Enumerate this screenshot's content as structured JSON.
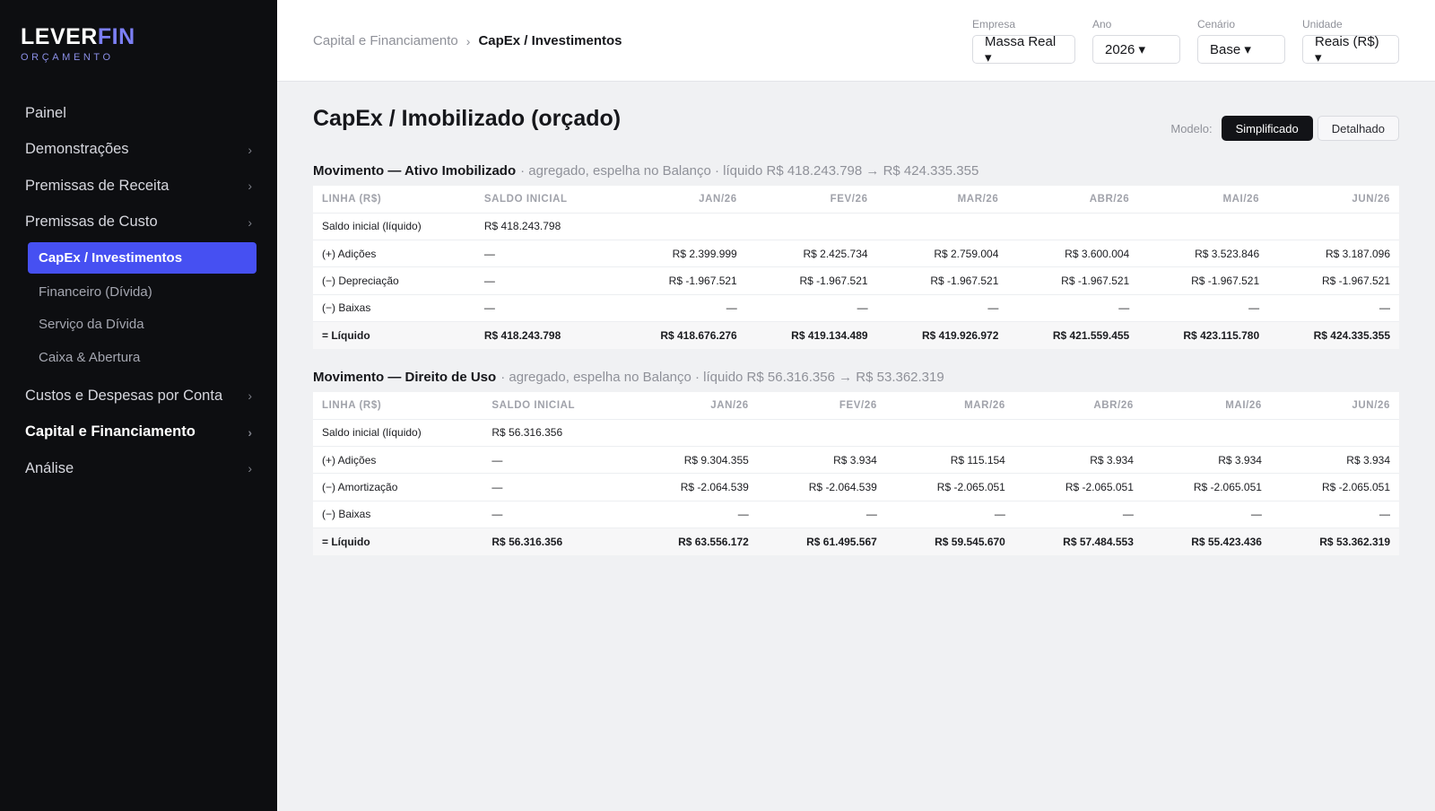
{
  "brand": {
    "main": "LEVER",
    "accent": "FIN",
    "sub": "ORÇAMENTO"
  },
  "nav": {
    "painel": "Painel",
    "demonstracoes": "Demonstrações",
    "premissas_receita": "Premissas de Receita",
    "premissas_custo": "Premissas de Custo",
    "sub_capex": "CapEx / Investimentos",
    "sub_financeiro": "Financeiro (Dívida)",
    "sub_servico": "Serviço da Dívida",
    "sub_caixa": "Caixa & Abertura",
    "custos_despesas": "Custos e Despesas por Conta",
    "capital_fin": "Capital e Financiamento",
    "analise": "Análise",
    "chevron": "›"
  },
  "breadcrumb": {
    "parent": "Capital e Financiamento",
    "sep": "›",
    "current": "CapEx / Investimentos"
  },
  "filters": {
    "empresa": {
      "label": "Empresa",
      "value": "Massa Real ▾"
    },
    "ano": {
      "label": "Ano",
      "value": "2026 ▾"
    },
    "cenario": {
      "label": "Cenário",
      "value": "Base ▾"
    },
    "unidade": {
      "label": "Unidade",
      "value": "Reais (R$) ▾"
    }
  },
  "page": {
    "title": "CapEx / Imobilizado (orçado)",
    "model_label": "Modelo:",
    "model_simplified": "Simplificado",
    "model_detailed": "Detalhado"
  },
  "sections": [
    {
      "title": "Movimento — Ativo Imobilizado",
      "subtitle": "· agregado, espelha no Balanço · líquido R$ 418.243.798 → R$ 424.335.355",
      "headers": [
        "LINHA (R$)",
        "SALDO INICIAL",
        "JAN/26",
        "FEV/26",
        "MAR/26",
        "ABR/26",
        "MAI/26",
        "JUN/26"
      ],
      "rows": [
        [
          "Saldo inicial (líquido)",
          "R$ 418.243.798",
          "",
          "",
          "",
          "",
          "",
          ""
        ],
        [
          "(+) Adições",
          "—",
          "R$ 2.399.999",
          "R$ 2.425.734",
          "R$ 2.759.004",
          "R$ 3.600.004",
          "R$ 3.523.846",
          "R$ 3.187.096"
        ],
        [
          "(−) Depreciação",
          "—",
          "R$ -1.967.521",
          "R$ -1.967.521",
          "R$ -1.967.521",
          "R$ -1.967.521",
          "R$ -1.967.521",
          "R$ -1.967.521"
        ],
        [
          "(−) Baixas",
          "—",
          "—",
          "—",
          "—",
          "—",
          "—",
          "—"
        ],
        [
          "= Líquido",
          "R$ 418.243.798",
          "R$ 418.676.276",
          "R$ 419.134.489",
          "R$ 419.926.972",
          "R$ 421.559.455",
          "R$ 423.115.780",
          "R$ 424.335.355"
        ]
      ]
    },
    {
      "title": "Movimento — Direito de Uso",
      "subtitle": "· agregado, espelha no Balanço · líquido R$ 56.316.356 → R$ 53.362.319",
      "headers": [
        "LINHA (R$)",
        "SALDO INICIAL",
        "JAN/26",
        "FEV/26",
        "MAR/26",
        "ABR/26",
        "MAI/26",
        "JUN/26"
      ],
      "rows": [
        [
          "Saldo inicial (líquido)",
          "R$ 56.316.356",
          "",
          "",
          "",
          "",
          "",
          ""
        ],
        [
          "(+) Adições",
          "—",
          "R$ 9.304.355",
          "R$ 3.934",
          "R$ 115.154",
          "R$ 3.934",
          "R$ 3.934",
          "R$ 3.934"
        ],
        [
          "(−) Amortização",
          "—",
          "R$ -2.064.539",
          "R$ -2.064.539",
          "R$ -2.065.051",
          "R$ -2.065.051",
          "R$ -2.065.051",
          "R$ -2.065.051"
        ],
        [
          "(−) Baixas",
          "—",
          "—",
          "—",
          "—",
          "—",
          "—",
          "—"
        ],
        [
          "= Líquido",
          "R$ 56.316.356",
          "R$ 63.556.172",
          "R$ 61.495.567",
          "R$ 59.545.670",
          "R$ 57.484.553",
          "R$ 55.423.436",
          "R$ 53.362.319"
        ]
      ]
    }
  ]
}
